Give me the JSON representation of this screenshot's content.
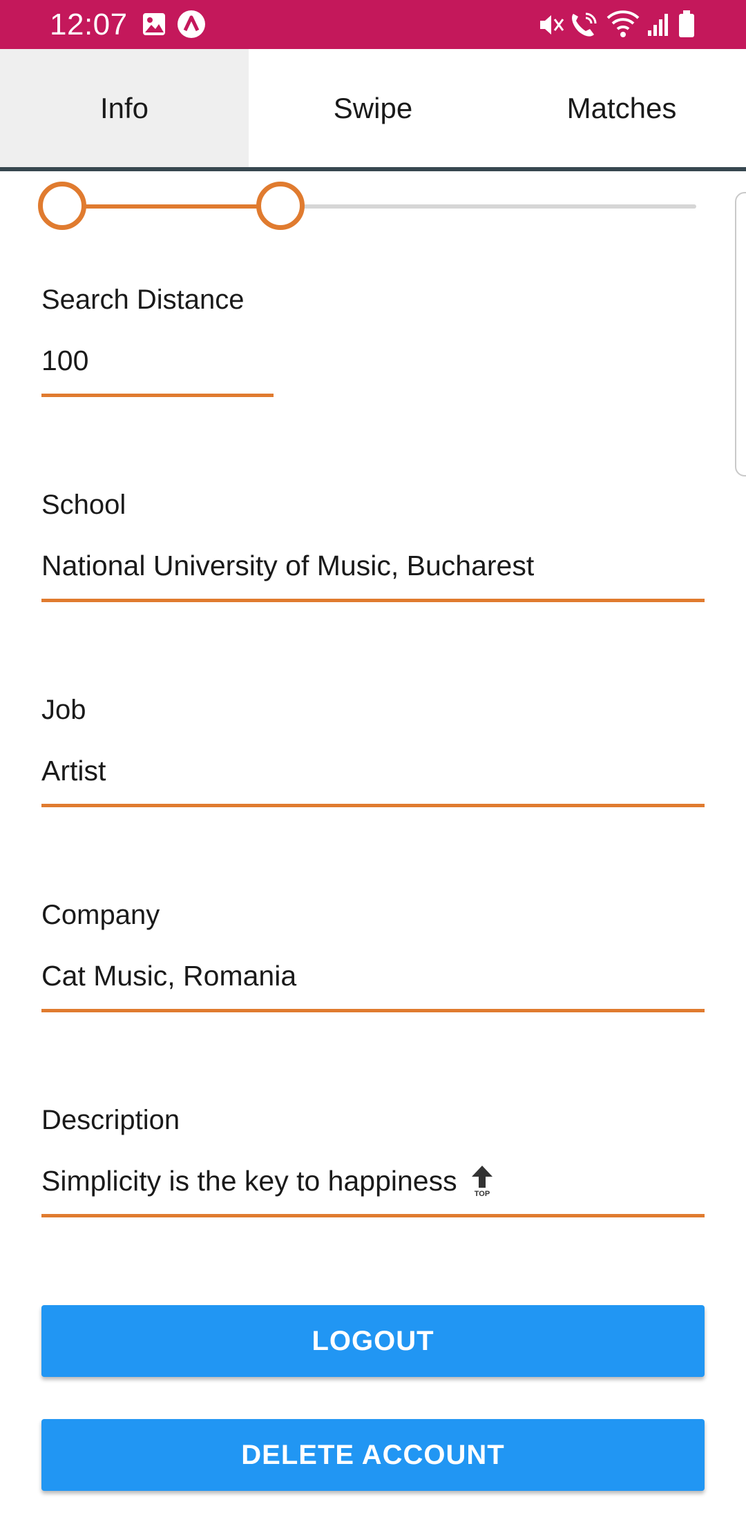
{
  "status_bar": {
    "time": "12:07",
    "bg_color": "#c4185b",
    "icons": [
      "image-icon",
      "app-a-icon",
      "mute-icon",
      "wifi-call-icon",
      "wifi-icon",
      "signal-icon",
      "battery-icon"
    ]
  },
  "tabs": [
    {
      "label": "Info",
      "active": true
    },
    {
      "label": "Swipe",
      "active": false
    },
    {
      "label": "Matches",
      "active": false
    }
  ],
  "age_range_slider": {
    "accent_color": "#e07b2f"
  },
  "fields": {
    "search_distance": {
      "label": "Search Distance",
      "value": "100"
    },
    "school": {
      "label": "School",
      "value": "National University of Music, Bucharest"
    },
    "job": {
      "label": "Job",
      "value": "Artist"
    },
    "company": {
      "label": "Company",
      "value": "Cat Music, Romania"
    },
    "description": {
      "label": "Description",
      "value": "Simplicity is the key to happiness",
      "emoji": "top-arrow-icon"
    }
  },
  "buttons": {
    "logout": "LOGOUT",
    "delete_account": "DELETE ACCOUNT",
    "color": "#2196f3"
  }
}
